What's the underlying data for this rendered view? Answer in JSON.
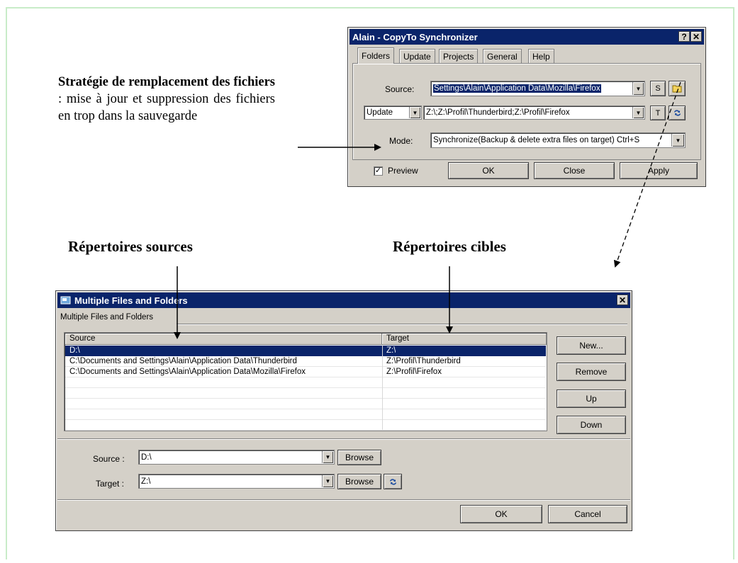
{
  "annotations": {
    "strategy_bold": "Stratégie de remplacement des fichiers",
    "strategy_rest": " : mise à jour et suppression des fichiers en trop dans la sauvegarde",
    "sources_heading": "Répertoires sources",
    "targets_heading": "Répertoires cibles"
  },
  "sync_dialog": {
    "title": "Alain - CopyTo Synchronizer",
    "help_btn": "?",
    "close_btn": "✕",
    "tabs": [
      "Folders",
      "Update",
      "Projects",
      "General",
      "Help"
    ],
    "source_label": "Source:",
    "source_value": "Settings\\Alain\\Application Data\\Mozilla\\Firefox",
    "s_button": "S",
    "update_select": "Update",
    "update_paths": "Z:\\;Z:\\Profil\\Thunderbird;Z:\\Profil\\Firefox",
    "t_button": "T",
    "mode_label": "Mode:",
    "mode_value": "Synchronize(Backup & delete extra files on target) Ctrl+S",
    "preview_label": "Preview",
    "preview_checked": "✓",
    "ok": "OK",
    "close": "Close",
    "apply": "Apply"
  },
  "multi_dialog": {
    "title": "Multiple Files and Folders",
    "close_btn": "✕",
    "group_label": "Multiple Files and Folders",
    "columns": [
      "Source",
      "Target"
    ],
    "rows": [
      {
        "source": "D:\\",
        "target": "Z:\\",
        "selected": true
      },
      {
        "source": "C:\\Documents and Settings\\Alain\\Application Data\\Thunderbird",
        "target": "Z:\\Profil\\Thunderbird"
      },
      {
        "source": "C:\\Documents and Settings\\Alain\\Application Data\\Mozilla\\Firefox",
        "target": "Z:\\Profil\\Firefox"
      }
    ],
    "side_buttons": [
      "New...",
      "Remove",
      "Up",
      "Down"
    ],
    "source_label": "Source :",
    "source_value": "D:\\",
    "target_label": "Target :",
    "target_value": "Z:\\",
    "browse": "Browse",
    "ok": "OK",
    "cancel": "Cancel"
  },
  "colors": {
    "titlebar": "#0a246a",
    "dialog_face": "#d4d0c8",
    "frame_border": "#c8ecc8"
  }
}
